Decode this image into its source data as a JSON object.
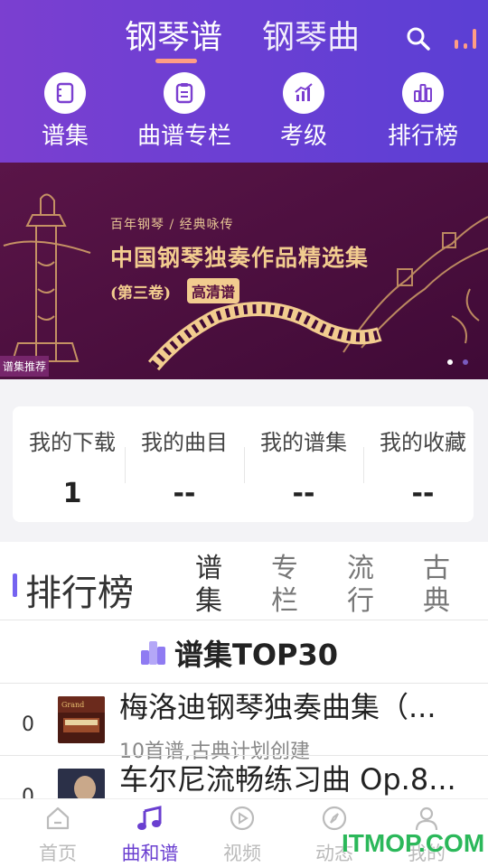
{
  "header": {
    "tabs": [
      "钢琴谱",
      "钢琴曲"
    ],
    "active_tab": 0,
    "accent": "#ff9d84",
    "icons": [
      "search-icon",
      "rank-bars-icon"
    ]
  },
  "categories": [
    {
      "label": "谱集",
      "icon": "notebook-icon"
    },
    {
      "label": "曲谱专栏",
      "icon": "clipboard-icon"
    },
    {
      "label": "考级",
      "icon": "growth-chart-icon"
    },
    {
      "label": "排行榜",
      "icon": "bar-chart-icon"
    }
  ],
  "banner": {
    "subtitle": "百年钢琴 / 经典咏传",
    "title": "中国钢琴独奏作品精选集",
    "volume": "(第三卷)",
    "badge": "高清谱",
    "tag": "谱集推荐",
    "slide_index": 0,
    "slide_count": 2
  },
  "stats": [
    {
      "label": "我的下载",
      "value": "1"
    },
    {
      "label": "我的曲目",
      "value": "--"
    },
    {
      "label": "我的谱集",
      "value": "--"
    },
    {
      "label": "我的收藏",
      "value": "--"
    }
  ],
  "ranking": {
    "title": "排行榜",
    "tabs": [
      "谱集",
      "专栏",
      "流行",
      "古典"
    ],
    "active_tab": 0,
    "list_title": "谱集TOP30",
    "items": [
      {
        "rank": "0",
        "title": "梅洛迪钢琴独奏曲集（...",
        "subtitle": "10首谱,古典计划创建"
      },
      {
        "rank": "0",
        "title": "车尔尼流畅练习曲 Op.8...",
        "subtitle": ""
      }
    ]
  },
  "bottom_nav": [
    {
      "label": "首页",
      "icon": "home-icon"
    },
    {
      "label": "曲和谱",
      "icon": "music-note-icon"
    },
    {
      "label": "视频",
      "icon": "play-icon"
    },
    {
      "label": "动态",
      "icon": "compass-icon"
    },
    {
      "label": "我的",
      "icon": "user-icon"
    }
  ],
  "bottom_nav_active": 1,
  "watermark": "ITMOP.COM"
}
